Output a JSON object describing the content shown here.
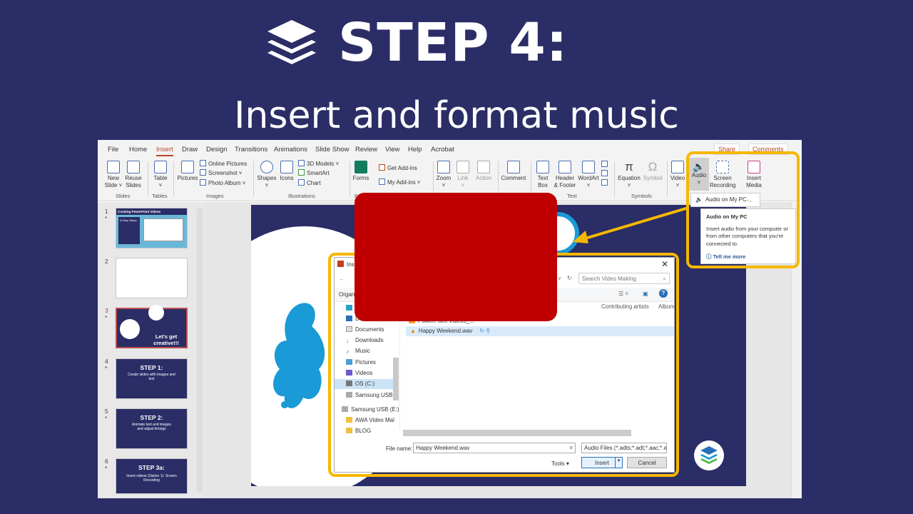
{
  "header": {
    "title": "STEP 4:",
    "subtitle": "Insert and format music"
  },
  "ribbon": {
    "tabs": [
      "File",
      "Home",
      "Insert",
      "Draw",
      "Design",
      "Transitions",
      "Animations",
      "Slide Show",
      "Review",
      "View",
      "Help",
      "Acrobat"
    ],
    "active_tab": "Insert",
    "share": "Share",
    "comments": "Comments",
    "new_slide": [
      "New",
      "Slide ˅"
    ],
    "reuse": [
      "Reuse",
      "Slides"
    ],
    "table": [
      "Table",
      "˅"
    ],
    "pictures": "Pictures",
    "online_pictures": "Online Pictures",
    "screenshot": "Screenshot ˅",
    "photo_album": "Photo Album ˅",
    "shapes": [
      "Shapes",
      "˅"
    ],
    "icons": "Icons",
    "models": "3D Models ˅",
    "smartart": "SmartArt",
    "chart": "Chart",
    "forms": "Forms",
    "get_addins": "Get Add-ins",
    "my_addins": "My Add-ins ˅",
    "zoom": [
      "Zoom",
      "˅"
    ],
    "link": [
      "Link",
      "˅"
    ],
    "action": "Action",
    "comment": "Comment",
    "textbox": [
      "Text",
      "Box"
    ],
    "header_footer": [
      "Header",
      "& Footer"
    ],
    "wordart": [
      "WordArt",
      "˅"
    ],
    "equation": [
      "Equation",
      "˅"
    ],
    "symbol": "Symbol",
    "video": [
      "Video",
      "˅"
    ],
    "audio": [
      "Audio",
      "˅"
    ],
    "screen_recording": [
      "Screen",
      "Recording"
    ],
    "insert_media": [
      "Insert",
      "Media"
    ],
    "groups": [
      "Slides",
      "Tables",
      "Images",
      "Illustrations",
      "F",
      "Text",
      "Symbols"
    ],
    "audio_menu_item": "Audio on My PC..."
  },
  "tooltip": {
    "title": "Audio on My PC",
    "body": "Insert audio from your computer or from other computers that you're connected to.",
    "link": "Tell me more"
  },
  "thumbnails": [
    {
      "num": "1",
      "star": "*",
      "title": "Creating PowerPoint Videos",
      "sub": "5 Easy Steps:"
    },
    {
      "num": "2",
      "star": ""
    },
    {
      "num": "3",
      "star": "*",
      "text": "Let's get creative!!!"
    },
    {
      "num": "4",
      "star": "*",
      "title": "STEP 1:",
      "text": "Create slides with images and text"
    },
    {
      "num": "5",
      "star": "*",
      "title": "STEP 2:",
      "text": "Animate text and images and adjust timings"
    },
    {
      "num": "6",
      "star": "*",
      "title": "STEP 3a:",
      "text": "Insert videos (Option 1): Screen Recording"
    }
  ],
  "dialog": {
    "title": "Insert Audio",
    "search_placeholder": "Search Video Making",
    "organize": "Organize ˅",
    "col_artists": "Contributing artists",
    "col_album": "Album",
    "files": [
      "PowerPoint Videos_...",
      "Happy Weekend.wav"
    ],
    "sidebar": [
      "D",
      "Documents",
      "Downloads",
      "Music",
      "Pictures",
      "Videos",
      "OS (C:)",
      "Samsung USB (",
      "Samsung USB (E:)",
      "AWA Video Mal",
      "BLOG"
    ],
    "filename_label": "File name:",
    "filename": "Happy Weekend.wav",
    "filter": "Audio Files (*.adts;*.adt;*.aac;*.a",
    "tools": "Tools",
    "insert": "Insert",
    "cancel": "Cancel"
  },
  "colors": {
    "accent": "#f5b800",
    "bg": "#2a2d66",
    "ppt_red": "#b7472a",
    "redact": "#c00000"
  }
}
